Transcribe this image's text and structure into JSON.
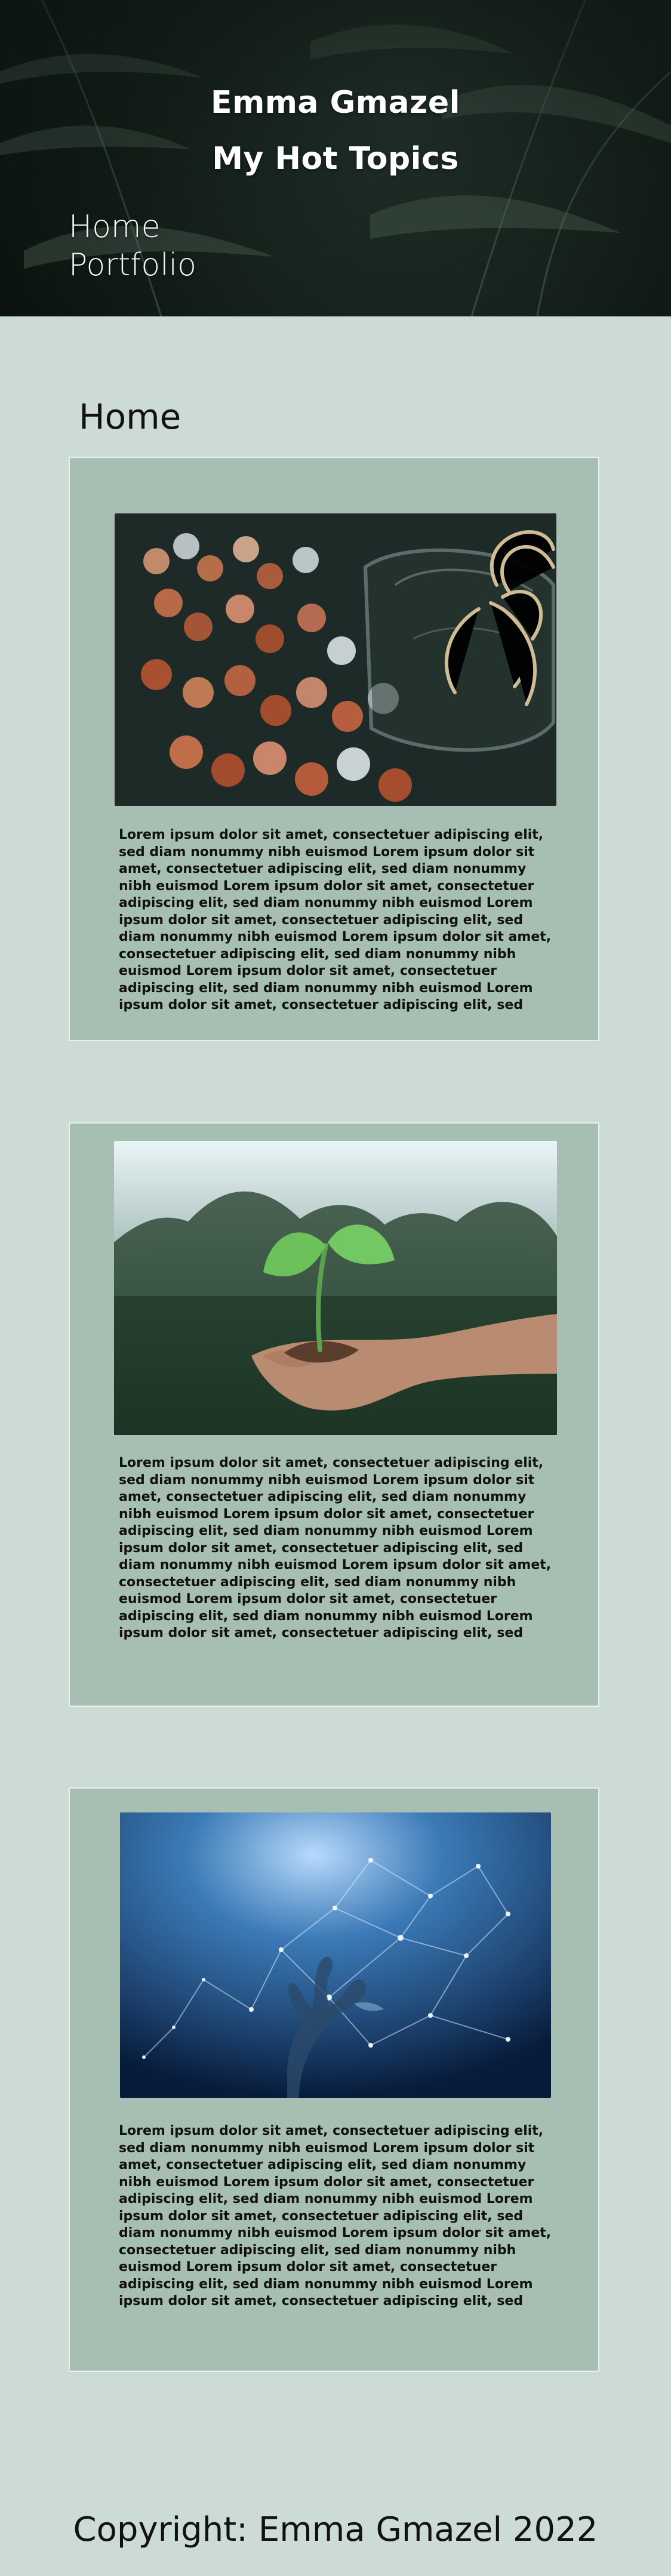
{
  "header": {
    "name": "Emma Gmazel",
    "topics": "My Hot Topics",
    "nav": [
      "Home",
      "Portfolio"
    ]
  },
  "page": {
    "heading": "Home"
  },
  "cards": [
    {
      "image": "coins-jar-image",
      "text": "Lorem ipsum dolor sit amet, consectetuer adipiscing elit, sed diam nonummy nibh euismod Lorem ipsum dolor sit amet, consectetuer adipiscing elit, sed diam nonummy nibh euismod Lorem ipsum dolor sit amet, consectetuer adipiscing elit, sed diam nonummy nibh euismod Lorem ipsum dolor sit amet, consectetuer adipiscing elit, sed diam nonummy nibh euismod Lorem ipsum dolor sit amet, consectetuer adipiscing elit, sed diam nonummy nibh euismod Lorem ipsum dolor sit amet, consectetuer adipiscing elit, sed diam nonummy nibh euismod Lorem ipsum dolor sit amet, consectetuer adipiscing elit, sed"
    },
    {
      "image": "sprout-hand-image",
      "text": "Lorem ipsum dolor sit amet, consectetuer adipiscing elit, sed diam nonummy nibh euismod Lorem ipsum dolor sit amet, consectetuer adipiscing elit, sed diam nonummy nibh euismod Lorem ipsum dolor sit amet, consectetuer adipiscing elit, sed diam nonummy nibh euismod Lorem ipsum dolor sit amet, consectetuer adipiscing elit, sed diam nonummy nibh euismod Lorem ipsum dolor sit amet, consectetuer adipiscing elit, sed diam nonummy nibh euismod Lorem ipsum dolor sit amet, consectetuer adipiscing elit, sed diam nonummy nibh euismod Lorem ipsum dolor sit amet, consectetuer adipiscing elit, sed"
    },
    {
      "image": "network-robot-hand-image",
      "text": "Lorem ipsum dolor sit amet, consectetuer adipiscing elit, sed diam nonummy nibh euismod Lorem ipsum dolor sit amet, consectetuer adipiscing elit, sed diam nonummy nibh euismod Lorem ipsum dolor sit amet, consectetuer adipiscing elit, sed diam nonummy nibh euismod Lorem ipsum dolor sit amet, consectetuer adipiscing elit, sed diam nonummy nibh euismod Lorem ipsum dolor sit amet, consectetuer adipiscing elit, sed diam nonummy nibh euismod Lorem ipsum dolor sit amet, consectetuer adipiscing elit, sed diam nonummy nibh euismod Lorem ipsum dolor sit amet, consectetuer adipiscing elit, sed"
    }
  ],
  "footer": {
    "copyright": "Copyright: Emma Gmazel 2022"
  },
  "colors": {
    "page_bg": "#cddbd6",
    "card_bg": "#a7beb3",
    "header_bg": "#111b16",
    "text": "#111111"
  }
}
